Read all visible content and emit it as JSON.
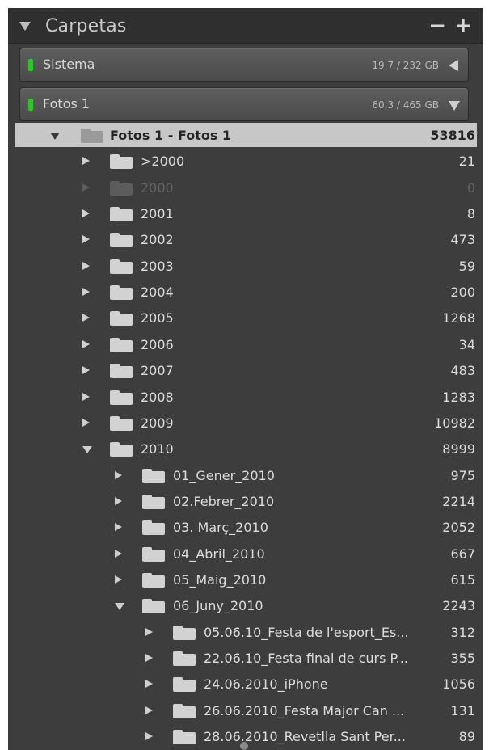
{
  "panel": {
    "title": "Carpetas",
    "minus_label": "−",
    "plus_label": "+"
  },
  "volumes": [
    {
      "name": "Sistema",
      "size": "19,7 / 232 GB",
      "indicator_color": "#2ec52b",
      "state": "collapsed"
    },
    {
      "name": "Fotos 1",
      "size": "60,3 / 465 GB",
      "indicator_color": "#2ec52b",
      "state": "expanded"
    }
  ],
  "tree": [
    {
      "label": "Fotos 1 - Fotos 1",
      "count": "53816",
      "expanded": true,
      "selected": true,
      "level": 0
    },
    {
      "label": ">2000",
      "count": "21",
      "expanded": false,
      "level": 1
    },
    {
      "label": "2000",
      "count": "0",
      "expanded": false,
      "offline": true,
      "level": 1
    },
    {
      "label": "2001",
      "count": "8",
      "expanded": false,
      "level": 1
    },
    {
      "label": "2002",
      "count": "473",
      "expanded": false,
      "level": 1
    },
    {
      "label": "2003",
      "count": "59",
      "expanded": false,
      "level": 1
    },
    {
      "label": "2004",
      "count": "200",
      "expanded": false,
      "level": 1
    },
    {
      "label": "2005",
      "count": "1268",
      "expanded": false,
      "level": 1
    },
    {
      "label": "2006",
      "count": "34",
      "expanded": false,
      "level": 1
    },
    {
      "label": "2007",
      "count": "483",
      "expanded": false,
      "level": 1
    },
    {
      "label": "2008",
      "count": "1283",
      "expanded": false,
      "level": 1
    },
    {
      "label": "2009",
      "count": "10982",
      "expanded": false,
      "level": 1
    },
    {
      "label": "2010",
      "count": "8999",
      "expanded": true,
      "level": 1
    },
    {
      "label": "01_Gener_2010",
      "count": "975",
      "expanded": false,
      "level": 2
    },
    {
      "label": "02.Febrer_2010",
      "count": "2214",
      "expanded": false,
      "level": 2
    },
    {
      "label": "03. Març_2010",
      "count": "2052",
      "expanded": false,
      "level": 2
    },
    {
      "label": "04_Abril_2010",
      "count": "667",
      "expanded": false,
      "level": 2
    },
    {
      "label": "05_Maig_2010",
      "count": "615",
      "expanded": false,
      "level": 2
    },
    {
      "label": "06_Juny_2010",
      "count": "2243",
      "expanded": true,
      "level": 2
    },
    {
      "label": "05.06.10_Festa de l'esport_Es...",
      "count": "312",
      "expanded": false,
      "level": 3
    },
    {
      "label": "22.06.10_Festa final de curs P...",
      "count": "355",
      "expanded": false,
      "level": 3
    },
    {
      "label": "24.06.2010_iPhone",
      "count": "1056",
      "expanded": false,
      "level": 3
    },
    {
      "label": "26.06.2010_Festa Major Can ...",
      "count": "131",
      "expanded": false,
      "level": 3
    },
    {
      "label": "28.06.2010_Revetlla Sant Per...",
      "count": "89",
      "expanded": false,
      "level": 3
    }
  ]
}
